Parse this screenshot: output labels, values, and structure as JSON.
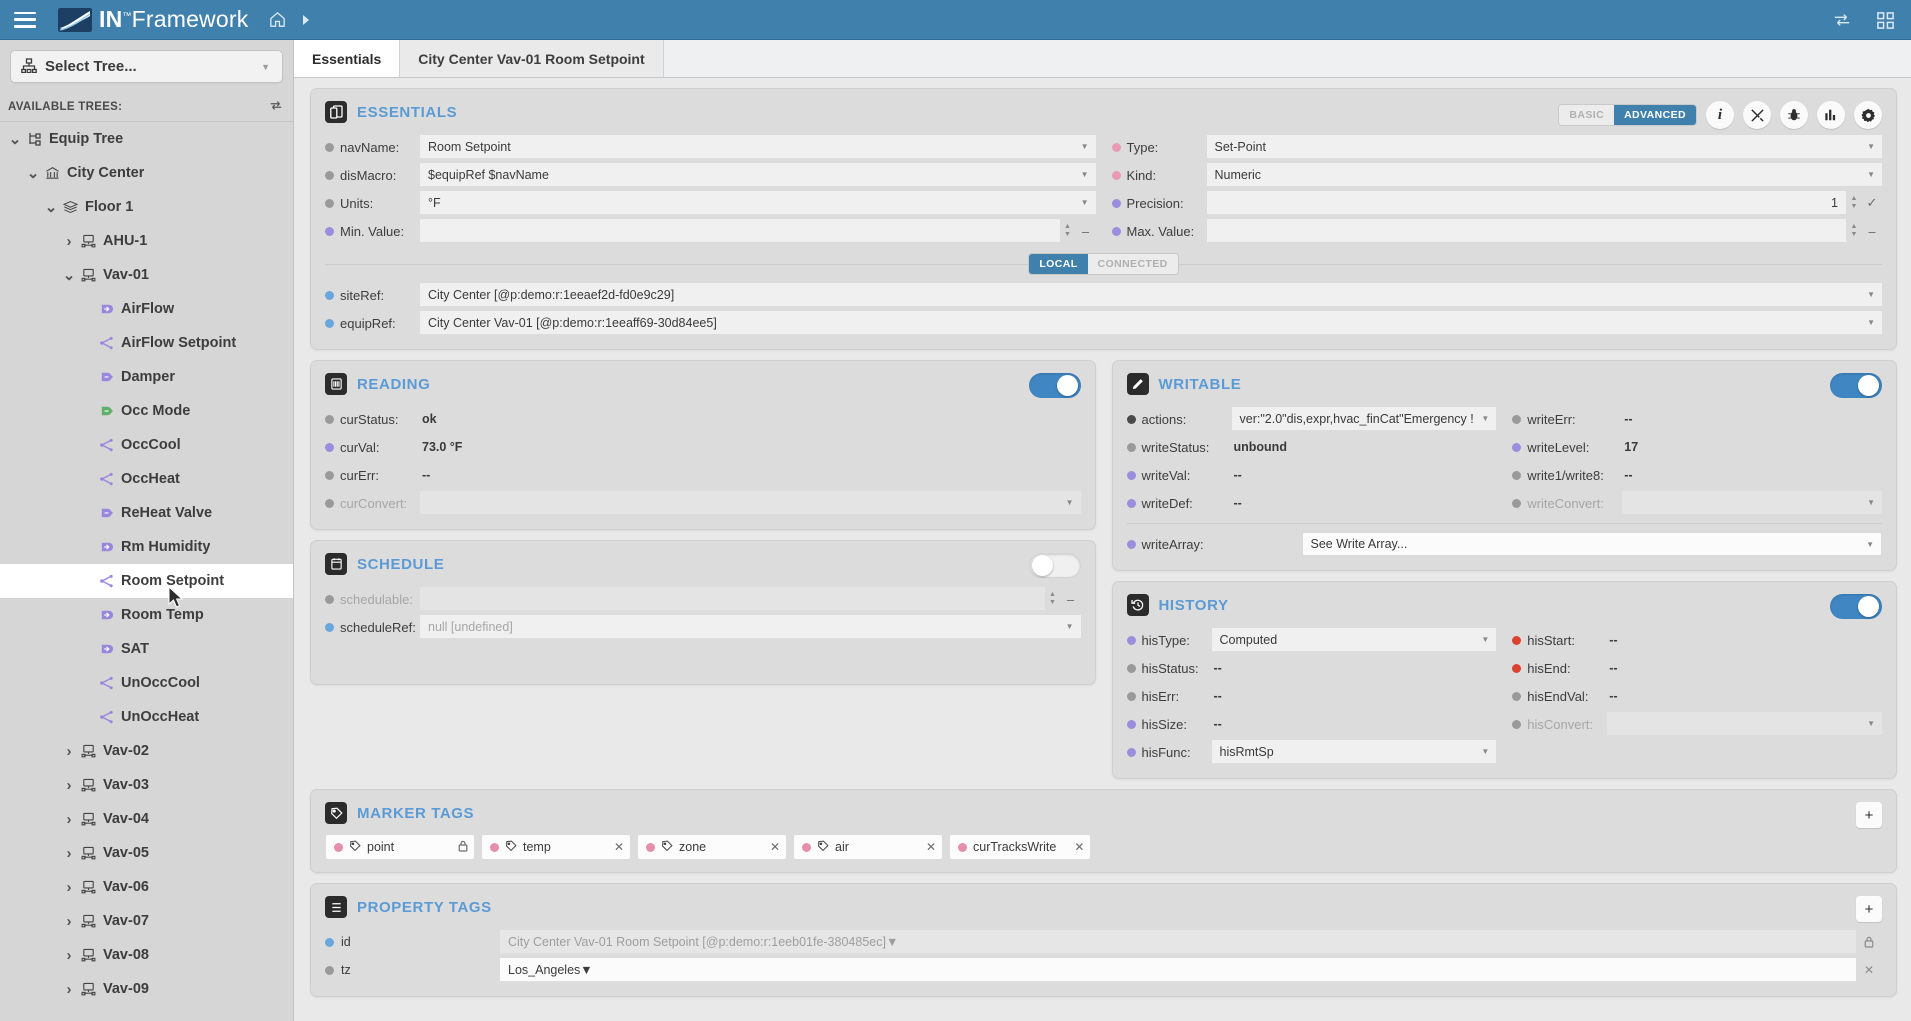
{
  "topbar": {
    "menu_icon": "hamburger-icon",
    "brand_prefix": "IN",
    "brand_sup": "™",
    "brand_suffix": "Framework",
    "home_icon": "home-icon",
    "next_icon": "chevron-right-icon",
    "sync_icon": "sync-icon",
    "apps_icon": "apps-grid-icon",
    "bg_color": "#4080ac"
  },
  "sidebar": {
    "select_tree_label": "Select Tree...",
    "select_tree_icon": "tree-icon",
    "available_trees_label": "AVAILABLE TREES:",
    "refresh_icon": "refresh-icon",
    "items": [
      {
        "label": "Equip Tree",
        "indent": 0,
        "twisty": "down",
        "icon": "tree-structure-icon",
        "selected": false
      },
      {
        "label": "City Center",
        "indent": 1,
        "twisty": "down",
        "icon": "site-icon",
        "selected": false
      },
      {
        "label": "Floor 1",
        "indent": 2,
        "twisty": "down",
        "icon": "floor-icon",
        "selected": false
      },
      {
        "label": "AHU-1",
        "indent": 3,
        "twisty": "right",
        "icon": "equip-icon",
        "selected": false
      },
      {
        "label": "Vav-01",
        "indent": 3,
        "twisty": "down",
        "icon": "equip-icon",
        "selected": false
      },
      {
        "label": "AirFlow",
        "indent": 4,
        "twisty": "none",
        "icon": "point-in-icon",
        "selected": false
      },
      {
        "label": "AirFlow Setpoint",
        "indent": 4,
        "twisty": "none",
        "icon": "point-share-icon",
        "selected": false
      },
      {
        "label": "Damper",
        "indent": 4,
        "twisty": "none",
        "icon": "point-out-icon",
        "selected": false
      },
      {
        "label": "Occ Mode",
        "indent": 4,
        "twisty": "none",
        "icon": "point-out-green-icon",
        "selected": false
      },
      {
        "label": "OccCool",
        "indent": 4,
        "twisty": "none",
        "icon": "point-share-icon",
        "selected": false
      },
      {
        "label": "OccHeat",
        "indent": 4,
        "twisty": "none",
        "icon": "point-share-icon",
        "selected": false
      },
      {
        "label": "ReHeat Valve",
        "indent": 4,
        "twisty": "none",
        "icon": "point-out-icon",
        "selected": false
      },
      {
        "label": "Rm Humidity",
        "indent": 4,
        "twisty": "none",
        "icon": "point-in-icon",
        "selected": false
      },
      {
        "label": "Room Setpoint",
        "indent": 4,
        "twisty": "none",
        "icon": "point-share-icon",
        "selected": true
      },
      {
        "label": "Room Temp",
        "indent": 4,
        "twisty": "none",
        "icon": "point-in-icon",
        "selected": false
      },
      {
        "label": "SAT",
        "indent": 4,
        "twisty": "none",
        "icon": "point-in-icon",
        "selected": false
      },
      {
        "label": "UnOccCool",
        "indent": 4,
        "twisty": "none",
        "icon": "point-share-icon",
        "selected": false
      },
      {
        "label": "UnOccHeat",
        "indent": 4,
        "twisty": "none",
        "icon": "point-share-icon",
        "selected": false
      },
      {
        "label": "Vav-02",
        "indent": 3,
        "twisty": "right",
        "icon": "equip-icon",
        "selected": false
      },
      {
        "label": "Vav-03",
        "indent": 3,
        "twisty": "right",
        "icon": "equip-icon",
        "selected": false
      },
      {
        "label": "Vav-04",
        "indent": 3,
        "twisty": "right",
        "icon": "equip-icon",
        "selected": false
      },
      {
        "label": "Vav-05",
        "indent": 3,
        "twisty": "right",
        "icon": "equip-icon",
        "selected": false
      },
      {
        "label": "Vav-06",
        "indent": 3,
        "twisty": "right",
        "icon": "equip-icon",
        "selected": false
      },
      {
        "label": "Vav-07",
        "indent": 3,
        "twisty": "right",
        "icon": "equip-icon",
        "selected": false
      },
      {
        "label": "Vav-08",
        "indent": 3,
        "twisty": "right",
        "icon": "equip-icon",
        "selected": false
      },
      {
        "label": "Vav-09",
        "indent": 3,
        "twisty": "right",
        "icon": "equip-icon",
        "selected": false
      }
    ]
  },
  "tabs": [
    {
      "label": "Essentials",
      "active": true
    },
    {
      "label": "City Center Vav-01 Room Setpoint",
      "active": false
    }
  ],
  "essentials": {
    "title": "ESSENTIALS",
    "icon": "essentials-icon",
    "mode_basic": "BASIC",
    "mode_advanced": "ADVANCED",
    "mode_selected": "ADVANCED",
    "tool_icons": [
      "info-icon",
      "tools-icon",
      "bug-icon",
      "chart-icon",
      "gear-icon"
    ],
    "left_fields": [
      {
        "label": "navName:",
        "value": "Room Setpoint",
        "dot": "gray",
        "control": "select"
      },
      {
        "label": "disMacro:",
        "value": "$equipRef $navName",
        "dot": "gray",
        "control": "select"
      },
      {
        "label": "Units:",
        "value": "°F",
        "dot": "gray",
        "control": "select"
      },
      {
        "label": "Min. Value:",
        "value": "",
        "dot": "purple",
        "control": "spinner"
      }
    ],
    "right_fields": [
      {
        "label": "Type:",
        "value": "Set-Point",
        "dot": "pink",
        "control": "select"
      },
      {
        "label": "Kind:",
        "value": "Numeric",
        "dot": "pink",
        "control": "select"
      },
      {
        "label": "Precision:",
        "value": "1",
        "dot": "purple",
        "control": "spinner-check"
      },
      {
        "label": "Max. Value:",
        "value": "",
        "dot": "purple",
        "control": "spinner"
      }
    ],
    "local_label": "LOCAL",
    "connected_label": "CONNECTED",
    "scope_selected": "LOCAL",
    "refs": [
      {
        "label": "siteRef:",
        "value": "City Center [@p:demo:r:1eeaef2d-fd0e9c29]",
        "dot": "blue"
      },
      {
        "label": "equipRef:",
        "value": "City Center Vav-01 [@p:demo:r:1eeaff69-30d84ee5]",
        "dot": "blue"
      }
    ]
  },
  "reading": {
    "title": "READING",
    "icon": "reading-icon",
    "enabled": true,
    "fields": [
      {
        "label": "curStatus:",
        "value": "ok",
        "dot": "gray",
        "type": "text"
      },
      {
        "label": "curVal:",
        "value": "73.0 °F",
        "dot": "purple",
        "type": "text"
      },
      {
        "label": "curErr:",
        "value": "--",
        "dot": "gray",
        "type": "text"
      },
      {
        "label": "curConvert:",
        "value": "",
        "dot": "gray",
        "type": "select-dim"
      }
    ]
  },
  "writable": {
    "title": "WRITABLE",
    "icon": "writable-icon",
    "enabled": true,
    "left_fields": [
      {
        "label": "actions:",
        "value": "ver:\"2.0\"dis,expr,hvac_finCat\"Emergency !",
        "dot": "dark",
        "type": "select"
      },
      {
        "label": "writeStatus:",
        "value": "unbound",
        "dot": "gray",
        "type": "text"
      },
      {
        "label": "writeVal:",
        "value": "--",
        "dot": "purple",
        "type": "text"
      },
      {
        "label": "writeDef:",
        "value": "--",
        "dot": "purple",
        "type": "text"
      }
    ],
    "right_fields": [
      {
        "label": "writeErr:",
        "value": "--",
        "dot": "gray",
        "type": "text"
      },
      {
        "label": "writeLevel:",
        "value": "17",
        "dot": "purple",
        "type": "text"
      },
      {
        "label": "write1/write8:",
        "value": "--",
        "dot": "gray",
        "type": "text"
      },
      {
        "label": "writeConvert:",
        "value": "",
        "dot": "gray",
        "type": "select-dim"
      }
    ],
    "write_array_label": "writeArray:",
    "write_array_value": "See Write Array...",
    "write_array_dot": "purple"
  },
  "schedule": {
    "title": "SCHEDULE",
    "icon": "schedule-icon",
    "enabled": false,
    "fields": [
      {
        "label": "schedulable:",
        "value": "",
        "dot": "gray",
        "type": "spinner-dim"
      },
      {
        "label": "scheduleRef:",
        "value": "null [undefined]",
        "dot": "blue",
        "type": "select-placeholder"
      }
    ]
  },
  "history": {
    "title": "HISTORY",
    "icon": "history-icon",
    "enabled": true,
    "left_fields": [
      {
        "label": "hisType:",
        "value": "Computed",
        "dot": "purple",
        "type": "select"
      },
      {
        "label": "hisStatus:",
        "value": "--",
        "dot": "gray",
        "type": "text"
      },
      {
        "label": "hisErr:",
        "value": "--",
        "dot": "gray",
        "type": "text"
      },
      {
        "label": "hisSize:",
        "value": "--",
        "dot": "purple",
        "type": "text"
      },
      {
        "label": "hisFunc:",
        "value": "hisRmtSp",
        "dot": "purple",
        "type": "select"
      }
    ],
    "right_fields": [
      {
        "label": "hisStart:",
        "value": "--",
        "dot": "red",
        "type": "text"
      },
      {
        "label": "hisEnd:",
        "value": "--",
        "dot": "red",
        "type": "text"
      },
      {
        "label": "hisEndVal:",
        "value": "--",
        "dot": "gray",
        "type": "text"
      },
      {
        "label": "hisConvert:",
        "value": "",
        "dot": "gray",
        "type": "select-dim"
      }
    ]
  },
  "marker_tags": {
    "title": "MARKER TAGS",
    "icon": "marker-tags-icon",
    "add_label": "+",
    "tags": [
      {
        "label": "point",
        "action": "lock",
        "has_tag_icon": true
      },
      {
        "label": "temp",
        "action": "close",
        "has_tag_icon": true
      },
      {
        "label": "zone",
        "action": "close",
        "has_tag_icon": true
      },
      {
        "label": "air",
        "action": "close",
        "has_tag_icon": true
      },
      {
        "label": "curTracksWrite",
        "action": "close",
        "has_tag_icon": false
      }
    ]
  },
  "property_tags": {
    "title": "PROPERTY TAGS",
    "icon": "property-tags-icon",
    "add_label": "+",
    "rows": [
      {
        "label": "id",
        "value": "City Center Vav-01 Room Setpoint [@p:demo:r:1eeb01fe-380485ec]",
        "dot": "blue",
        "dim": true,
        "action": "lock"
      },
      {
        "label": "tz",
        "value": "Los_Angeles",
        "dot": "gray",
        "dim": false,
        "action": "close"
      }
    ]
  }
}
